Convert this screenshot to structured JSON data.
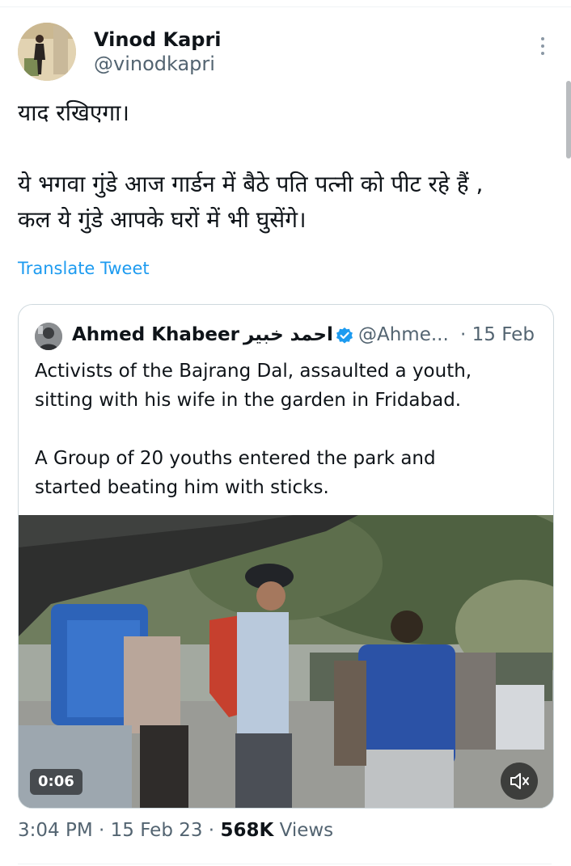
{
  "author": {
    "display_name": "Vinod Kapri",
    "handle": "@vinodkapri"
  },
  "tweet": {
    "line1": "याद रखिएगा।",
    "line2": "ये भगवा गुंडे आज गार्डन में बैठे पति पत्नी को पीट रहे हैं ,",
    "line3": "कल ये गुंडे आपके घरों में भी घुसेंगे।",
    "translate_label": "Translate Tweet"
  },
  "quoted_tweet": {
    "display_name": "Ahmed Khabeer",
    "arabic_name": "احمد خبير",
    "handle": "@Ahme...",
    "date": "· 15 Feb",
    "para1_line1": "Activists of the Bajrang Dal, assaulted a youth,",
    "para1_line2": "sitting with his wife in the garden in Fridabad.",
    "para2_line1": "A Group of 20 youths entered the park and",
    "para2_line2": "started beating him with sticks.",
    "video": {
      "duration": "0:06",
      "muted": true
    }
  },
  "meta": {
    "time": "3:04 PM",
    "date": "· 15 Feb 23 ·",
    "views_count": "568K",
    "views_label": "Views"
  },
  "colors": {
    "text": "#0f1419",
    "secondary": "#536471",
    "link": "#1d9bf0",
    "verified": "#1d9bf0",
    "border": "#cfd9de"
  },
  "icons": {
    "more": "more-vertical-icon",
    "verified": "verified-badge-icon",
    "mute": "speaker-muted-icon"
  }
}
